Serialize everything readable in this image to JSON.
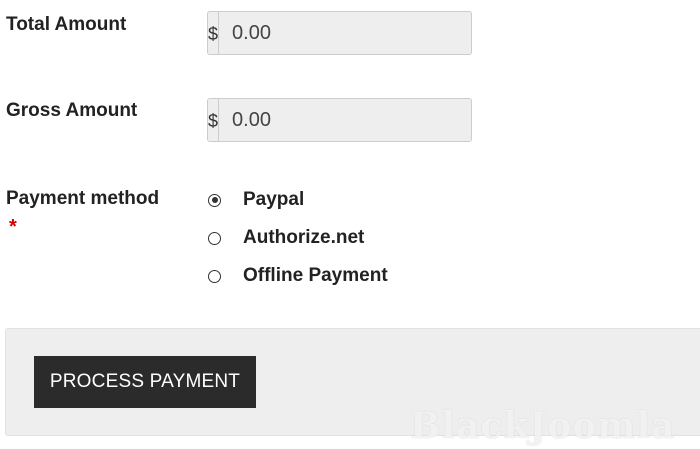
{
  "total_amount": {
    "label": "Total Amount",
    "currency_symbol": "$",
    "value": "0.00"
  },
  "gross_amount": {
    "label": "Gross Amount",
    "currency_symbol": "$",
    "value": "0.00"
  },
  "payment_method": {
    "label": "Payment method",
    "required_marker": "*",
    "selected": "Paypal",
    "options": [
      {
        "label": "Paypal",
        "checked": true
      },
      {
        "label": "Authorize.net",
        "checked": false
      },
      {
        "label": "Offline Payment",
        "checked": false
      }
    ]
  },
  "actions": {
    "process_label": "PROCESS PAYMENT"
  },
  "watermark": {
    "text": "BlackJoomla"
  },
  "colors": {
    "button_bg": "#2b2b2b",
    "panel_bg": "#eeeeee",
    "required": "#d40000"
  }
}
